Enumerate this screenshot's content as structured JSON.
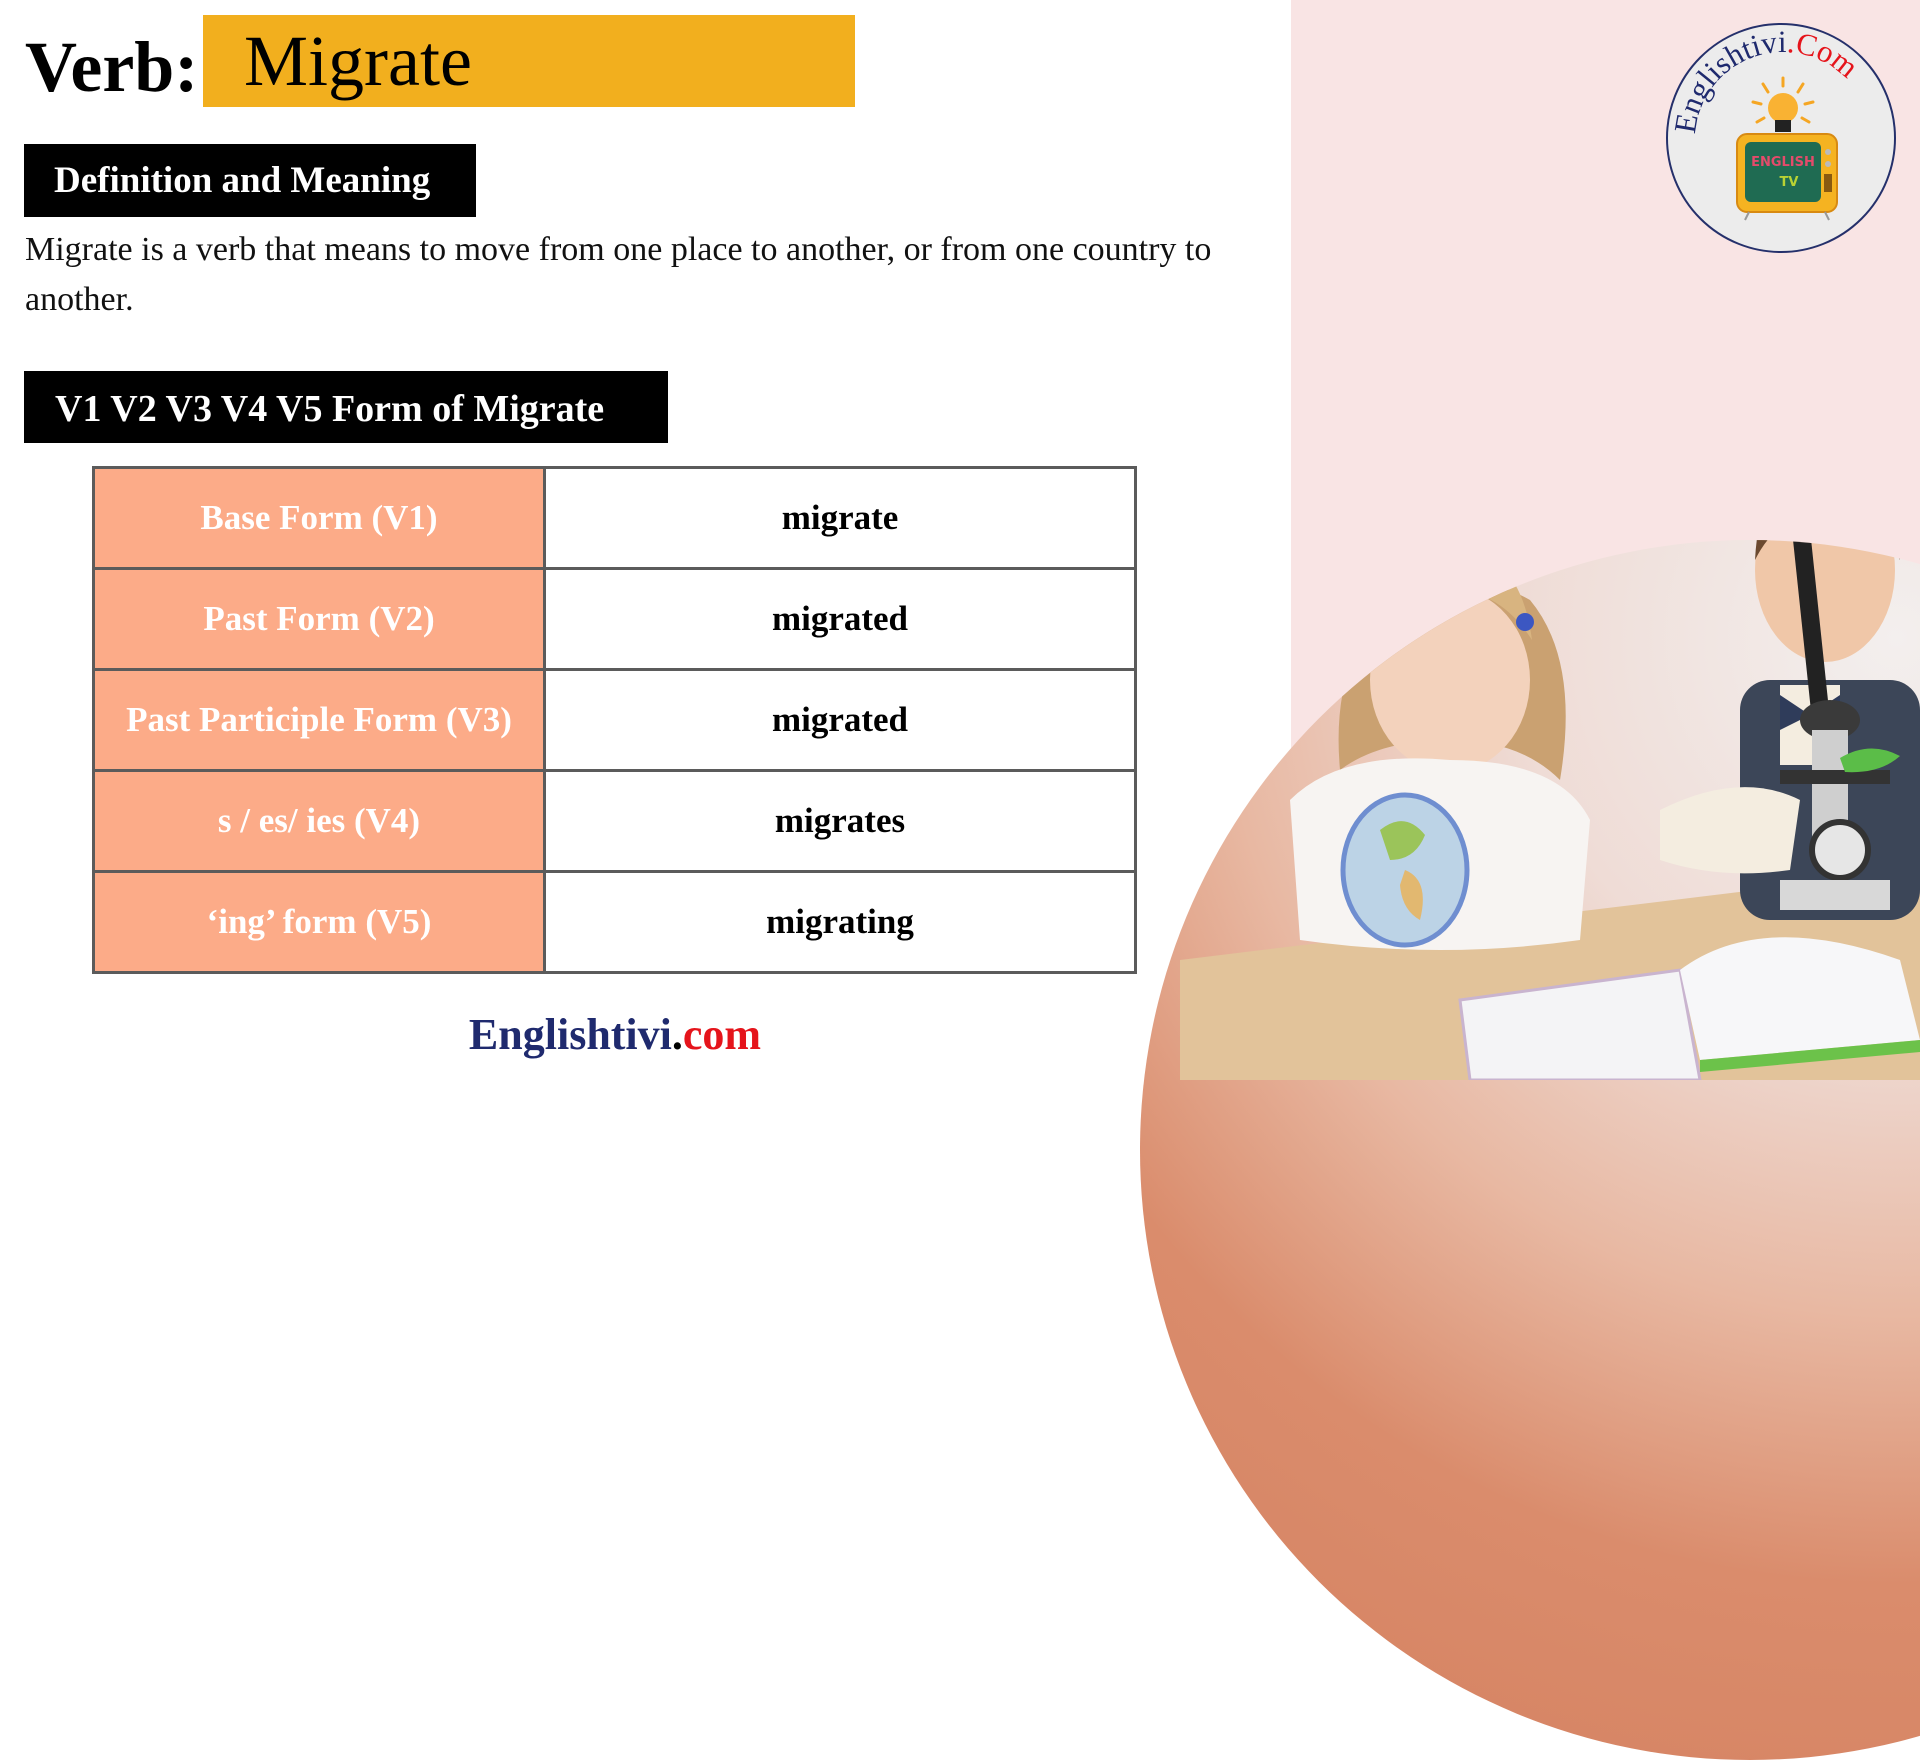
{
  "title": {
    "label": "Verb:",
    "word": "Migrate"
  },
  "definition": {
    "heading": "Definition and Meaning",
    "text": "Migrate is a verb that means to move from one place to another, or from one country to another."
  },
  "forms": {
    "heading": "V1 V2 V3 V4 V5 Form of Migrate",
    "rows": [
      {
        "label": "Base Form (V1)",
        "value": "migrate"
      },
      {
        "label": "Past Form (V2)",
        "value": "migrated"
      },
      {
        "label": "Past Participle Form (V3)",
        "value": "migrated"
      },
      {
        "label": "s / es/ ies (V4)",
        "value": "migrates"
      },
      {
        "label": "‘ing’ form (V5)",
        "value": "migrating"
      }
    ]
  },
  "footer": {
    "brand": "Englishtivi",
    "dot": ".",
    "tld": "com"
  },
  "logo": {
    "arc_text_main": "Englishtivi",
    "arc_text_tld": ".Com",
    "tv_text_line1": "ENGLISH",
    "tv_text_line2": "TV"
  },
  "illustration": {
    "description": "girl-with-globe-and-boy-with-microscope"
  },
  "colors": {
    "word_highlight": "#f2af1e",
    "section_bg": "#000000",
    "table_label_bg": "#fcab88",
    "table_border": "#5b5b5b",
    "panel_pink": "#f9e4e4",
    "arc_salmon": "#da8c6c",
    "brand_navy": "#1f2a6e",
    "brand_red": "#e5141b"
  }
}
